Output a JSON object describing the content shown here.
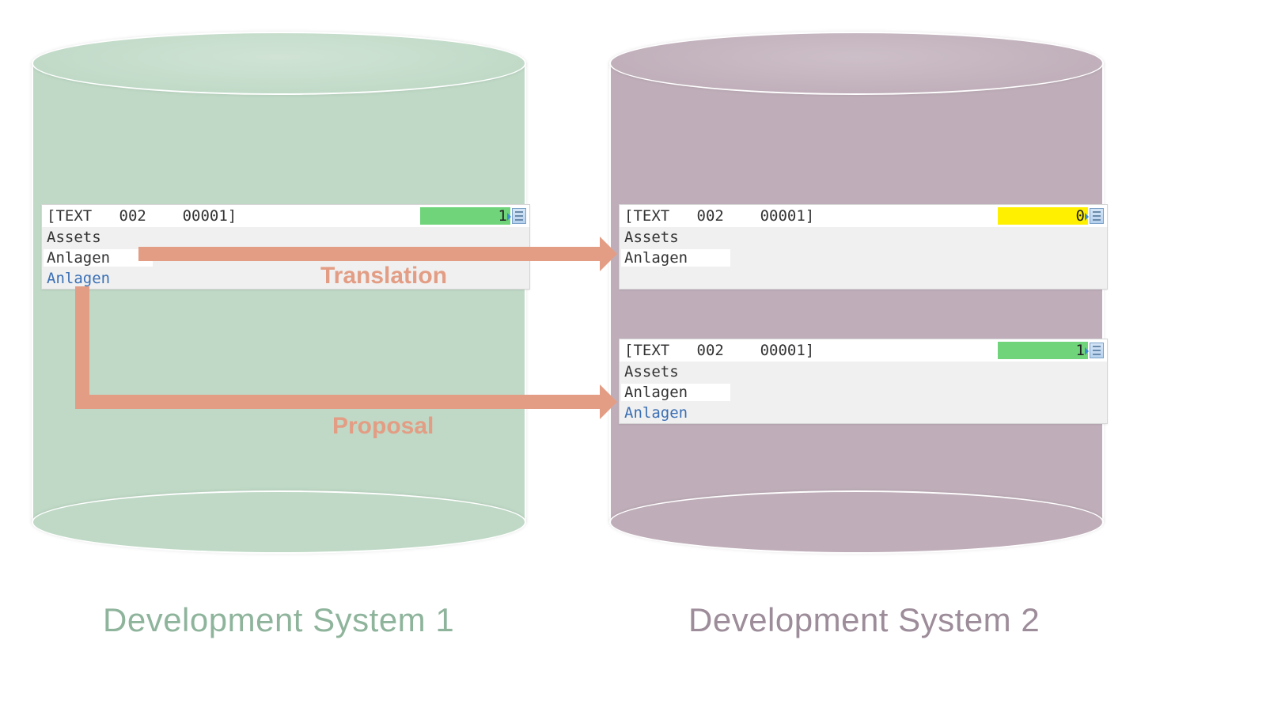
{
  "systems": {
    "left": {
      "caption": "Development System 1"
    },
    "right": {
      "caption": "Development System 2"
    }
  },
  "boxes": {
    "src": {
      "header": {
        "code": "[TEXT   002    00001]",
        "status_num": "1",
        "status_color": "green"
      },
      "assets": "Assets",
      "translation": "Anlagen",
      "proposal": "Anlagen"
    },
    "dst1": {
      "header": {
        "code": "[TEXT   002    00001]",
        "status_num": "0",
        "status_color": "yellow"
      },
      "assets": "Assets",
      "translation": "Anlagen",
      "proposal": ""
    },
    "dst2": {
      "header": {
        "code": "[TEXT   002    00001]",
        "status_num": "1",
        "status_color": "green"
      },
      "assets": "Assets",
      "translation": "Anlagen",
      "proposal": "Anlagen"
    }
  },
  "arrows": {
    "translation_label": "Translation",
    "proposal_label": "Proposal"
  },
  "colors": {
    "accent_arrow": "#e39d84",
    "cyl_left": "#bfd9c6",
    "cyl_right": "#bfaeb9"
  }
}
